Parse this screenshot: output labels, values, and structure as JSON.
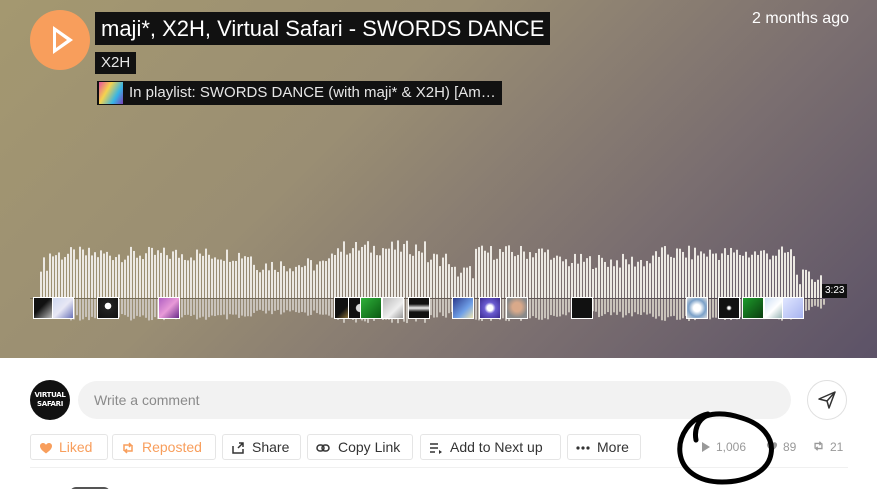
{
  "track": {
    "title": "maji*, X2H, Virtual Safari - SWORDS DANCE",
    "artist": "X2H",
    "playlist": "In playlist: SWORDS DANCE (with maji* & X2H) [Am…",
    "posted": "2 months ago",
    "duration": "3:23"
  },
  "player": {
    "play_icon": "play-icon",
    "accent_color": "#f89e5c",
    "progress_fraction": 0
  },
  "comment": {
    "placeholder": "Write a comment",
    "avatar_text": "VIRTUAL SAFARI",
    "send_icon": "send-icon"
  },
  "actions": {
    "liked": "Liked",
    "reposted": "Reposted",
    "share": "Share",
    "copy_link": "Copy Link",
    "add_next": "Add to Next up",
    "more": "More"
  },
  "stats": {
    "plays": "1,006",
    "likes": "89",
    "reposts": "21"
  }
}
